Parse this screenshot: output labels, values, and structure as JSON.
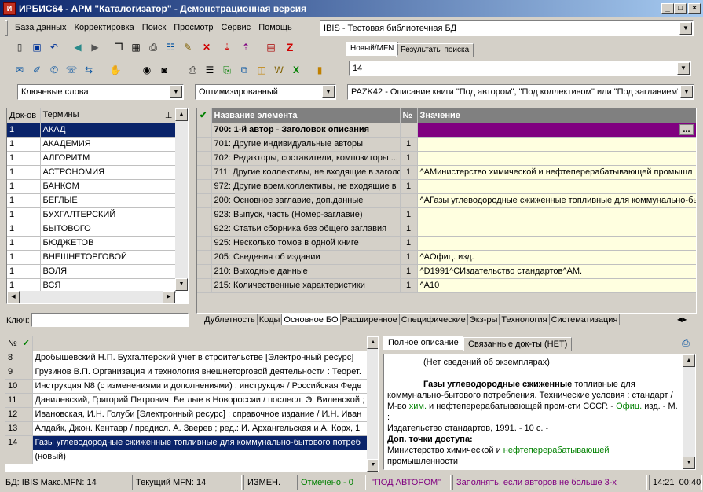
{
  "window": {
    "title": "ИРБИС64 - АРМ \"Каталогизатор\" - Демонстрационная версия",
    "app_icon_label": "И",
    "min": "_",
    "max": "□",
    "close": "×"
  },
  "menu": [
    "База данных",
    "Корректировка",
    "Поиск",
    "Просмотр",
    "Сервис",
    "Помощь"
  ],
  "db_combo": "IBIS - Тестовая библиотечная БД",
  "top_tabs": [
    "Новый/MFN",
    "Результаты поиска"
  ],
  "mfn_value": "14",
  "search_mode": "Ключевые слова",
  "search_type": "Оптимизированный",
  "worksheet": "PAZK42 - Описание книги \"Под автором\", \"Под коллективом\" или \"Под заглавием\"",
  "terms": {
    "headers": [
      "Док-ов",
      "Термины"
    ],
    "rows": [
      [
        "1",
        "АКАД"
      ],
      [
        "1",
        "АКАДЕМИЯ"
      ],
      [
        "1",
        "АЛГОРИТМ"
      ],
      [
        "1",
        "АСТРОНОМИЯ"
      ],
      [
        "1",
        "БАНКОМ"
      ],
      [
        "1",
        "БЕГЛЫЕ"
      ],
      [
        "1",
        "БУХГАЛТЕРСКИЙ"
      ],
      [
        "1",
        "БЫТОВОГО"
      ],
      [
        "1",
        "БЮДЖЕТОВ"
      ],
      [
        "1",
        "ВНЕШНЕТОРГОВОЙ"
      ],
      [
        "1",
        "ВОЛЯ"
      ],
      [
        "1",
        "ВСЯ"
      ]
    ],
    "key_label": "Ключ:"
  },
  "fields": {
    "headers": [
      "Название элемента",
      "№",
      "Значение"
    ],
    "rows": [
      [
        "700: 1-й автор - Заголовок описания",
        "",
        ""
      ],
      [
        "701: Другие индивидуальные авторы",
        "1",
        ""
      ],
      [
        "702: Редакторы, составители, композиторы ...",
        "1",
        ""
      ],
      [
        "711: Другие коллективы, не входящие в заголо",
        "1",
        "^AМинистерство химической и нефтеперерабатывающей промышл"
      ],
      [
        "972: Другие врем.коллективы, не входящие в",
        "1",
        ""
      ],
      [
        "200: Основное заглавие, доп.данные",
        "",
        "^AГазы углеводородные сжиженные топливные для коммунально-бы"
      ],
      [
        "923: Выпуск, часть (Номер-заглавие)",
        "1",
        ""
      ],
      [
        "922: Статьи сборника без общего заглавия",
        "1",
        ""
      ],
      [
        "925: Несколько томов в одной книге",
        "1",
        ""
      ],
      [
        "205: Сведения об издании",
        "1",
        "^AОфиц. изд."
      ],
      [
        "210: Выходные данные",
        "1",
        "^D1991^CИздательство стандартов^AM."
      ],
      [
        "215: Количественные характеристики",
        "1",
        "^A10"
      ]
    ],
    "ellipsis": "..."
  },
  "bottom_tabs": [
    "Дублетность",
    "Коды",
    "Основное БО",
    "Расширенное",
    "Специфические",
    "Экз-ры",
    "Технология",
    "Систематизация"
  ],
  "results": {
    "headers": [
      "№",
      ""
    ],
    "rows": [
      [
        "8",
        "Дробышевский Н.П. Бухгалтерский учет в строительстве [Электронный ресурс]"
      ],
      [
        "9",
        "Грузинов В.П. Организация и технология внешнеторговой деятельности : Теорет."
      ],
      [
        "10",
        "Инструкция N8   (с изменениями и дополнениями) : инструкция / Российская Феде"
      ],
      [
        "11",
        "Данилевский, Григорий Петрович. Беглые в Новороссии / послесл. Э. Виленской ;"
      ],
      [
        "12",
        "Ивановская, И.Н. Голуби [Электронный ресурс] : справочное издание / И.Н. Иван"
      ],
      [
        "13",
        "Алдайк, Джон. Кентавр / предисл. А. Зверев ; ред.: И. Архангельская и А. Корх, 1"
      ],
      [
        "14",
        "Газы углеводородные сжиженные топливные для коммунально-бытового потреб"
      ],
      [
        "",
        "(новый)"
      ]
    ]
  },
  "desc_tabs": [
    "Полное описание",
    "Связанные док-ты (НЕТ)"
  ],
  "description": {
    "l1": "(Нет сведений об экземплярах)",
    "l2_bold": "Газы углеводородные сжиженные",
    "l2_rest": " топливные для",
    "l3": "коммунально-бытового потребления. Технические условия : стандарт /",
    "l4a": "М-во ",
    "l4_link": "хим.",
    "l4b": " и нефтеперерабатывающей пром-сти СССР. - ",
    "l4_link2": "Офиц.",
    "l4c": " изд. - М. :",
    "l5": "Издательство стандартов, 1991. - 10 с. -",
    "l6": "Доп. точки доступа:",
    "l7a": "Министерство химической и ",
    "l7_link": "нефтеперерабатывающей",
    "l8": "промышленности"
  },
  "status": {
    "db": "БД: IBIS Макс.MFN: 14",
    "cur": "Текущий MFN: 14",
    "chg": "ИЗМЕН.",
    "marked": "Отмечено - 0",
    "ws": "\"ПОД АВТОРОМ\"",
    "hint": "Заполнять, если авторов не больше 3-х",
    "time": "14:21",
    "time2": "00:40"
  }
}
